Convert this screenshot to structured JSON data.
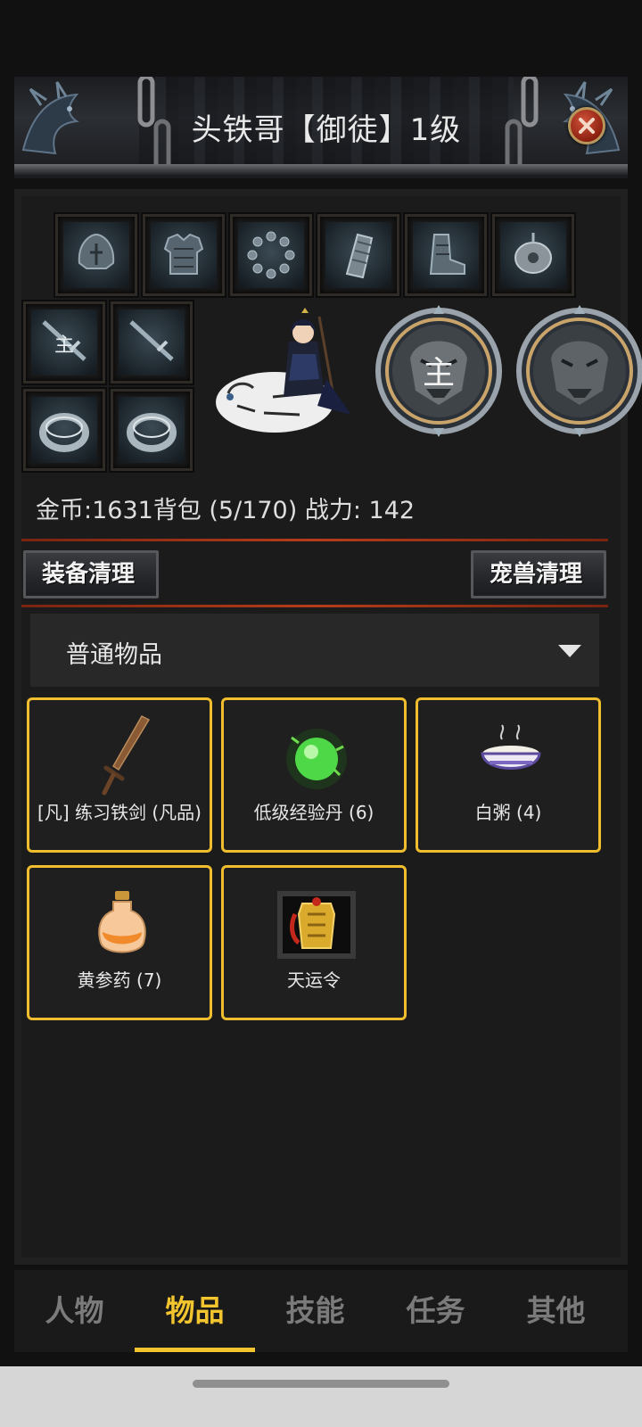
{
  "header": {
    "title": "头铁哥【御徒】1级"
  },
  "equipment": {
    "row1": [
      {
        "name": "helmet-icon"
      },
      {
        "name": "armor-icon"
      },
      {
        "name": "bead-necklace-icon"
      },
      {
        "name": "bracer-icon"
      },
      {
        "name": "boots-icon"
      },
      {
        "name": "jade-pendant-icon"
      }
    ],
    "weapon_mark": "主",
    "medal_mark": "主"
  },
  "stats": {
    "text": "金币:1631背包 (5/170) 战力: 142"
  },
  "actions": {
    "clean_equipment": "装备清理",
    "clean_pet": "宠兽清理"
  },
  "filter": {
    "selected": "普通物品"
  },
  "items": [
    {
      "name": "[凡] 练习铁剑 (凡品)",
      "icon": "sword-icon"
    },
    {
      "name": "低级经验丹 (6)",
      "icon": "green-pill-icon"
    },
    {
      "name": "白粥 (4)",
      "icon": "porridge-bowl-icon"
    },
    {
      "name": "黄参药 (7)",
      "icon": "potion-bottle-icon"
    },
    {
      "name": "天运令",
      "icon": "golden-token-icon"
    }
  ],
  "tabs": [
    {
      "label": "人物",
      "active": false
    },
    {
      "label": "物品",
      "active": true
    },
    {
      "label": "技能",
      "active": false
    },
    {
      "label": "任务",
      "active": false
    },
    {
      "label": "其他",
      "active": false
    }
  ],
  "colors": {
    "accent": "#f2c52e",
    "item_border": "#f0bd2e",
    "divider": "#b63c1a",
    "close": "#a82c18"
  }
}
